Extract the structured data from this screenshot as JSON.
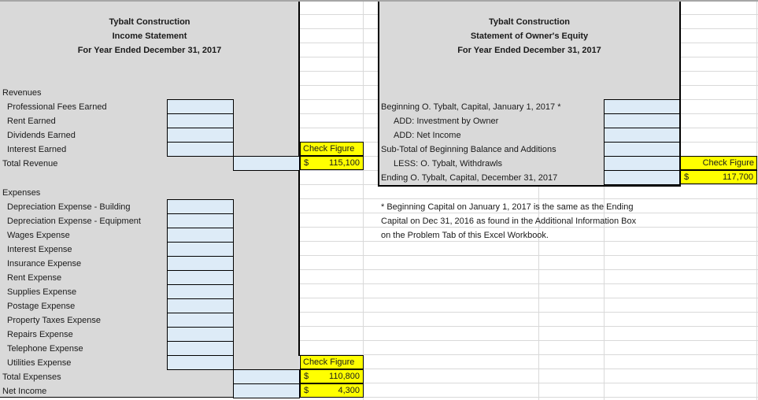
{
  "income_statement": {
    "title_lines": [
      "Tybalt Construction",
      "Income Statement",
      "For Year Ended December 31, 2017"
    ],
    "revenues_header": "Revenues",
    "revenue_items": [
      "Professional Fees Earned",
      "Rent Earned",
      "Dividends Earned",
      "Interest Earned"
    ],
    "total_revenue_label": "Total Revenue",
    "expenses_header": "Expenses",
    "expense_items": [
      "Depreciation Expense - Building",
      "Depreciation Expense - Equipment",
      "Wages Expense",
      "Interest Expense",
      "Insurance Expense",
      "Rent Expense",
      "Supplies Expense",
      "Postage Expense",
      "Property Taxes Expense",
      "Repairs Expense",
      "Telephone Expense",
      "Utilities Expense"
    ],
    "total_expenses_label": "Total Expenses",
    "net_income_label": "Net Income",
    "check_revenue": {
      "label": "Check Figure",
      "currency": "$",
      "value": "115,100"
    },
    "check_expenses": {
      "label": "Check Figure",
      "currency": "$",
      "value": "110,800"
    },
    "check_net_income": {
      "currency": "$",
      "value": "4,300"
    }
  },
  "owners_equity": {
    "title_lines": [
      "Tybalt Construction",
      "Statement of Owner's Equity",
      "For Year Ended December 31, 2017"
    ],
    "items": [
      "Beginning O. Tybalt, Capital, January 1, 2017 *",
      "ADD: Investment by Owner",
      "ADD: Net Income",
      "Sub-Total of Beginning Balance and Additions",
      "LESS: O. Tybalt, Withdrawls",
      "Ending O. Tybalt, Capital, December 31, 2017"
    ],
    "check_ending": {
      "label": "Check Figure",
      "currency": "$",
      "value": "117,700"
    },
    "footnote_lines": [
      "* Beginning Capital on January 1, 2017 is the same as the Ending",
      "Capital on Dec 31, 2016 as found in the Additional Information Box",
      "on the Problem Tab of this Excel Workbook."
    ]
  },
  "colors": {
    "panel_gray": "#d9d9d9",
    "input_blue": "#ddebf7",
    "check_yellow": "#ffff00",
    "gridline": "#d9d9d9"
  }
}
